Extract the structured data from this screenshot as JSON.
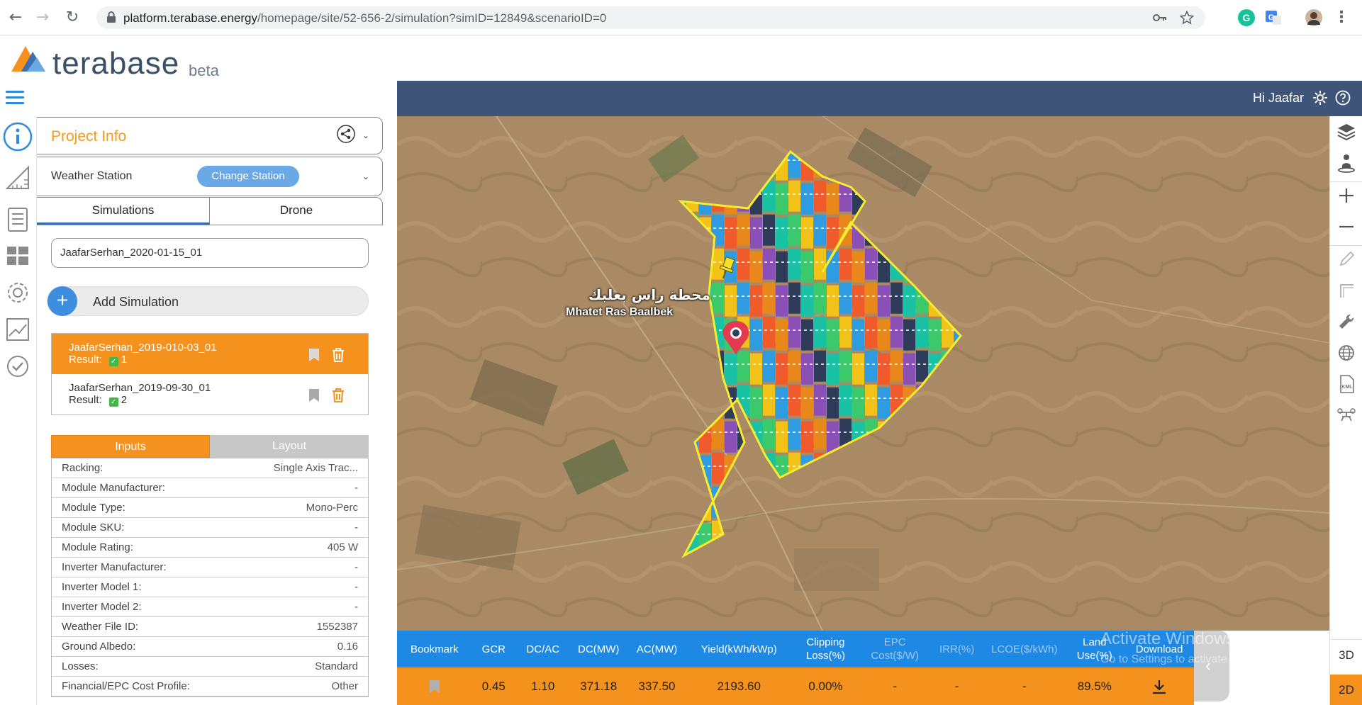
{
  "browser": {
    "url_host": "platform.terabase.energy",
    "url_path": "/homepage/site/52-656-2/simulation?simID=12849&scenarioID=0"
  },
  "app": {
    "logo_text": "terabase",
    "logo_badge": "beta",
    "greeting": "Hi Jaafar"
  },
  "panel": {
    "project_title": "Project Info",
    "weather_label": "Weather Station",
    "change_station_label": "Change Station",
    "tabs": [
      "Simulations",
      "Drone"
    ],
    "sim_name_value": "JaafarSerhan_2020-01-15_01",
    "add_simulation_label": "Add Simulation",
    "simulations": [
      {
        "name": "JaafarSerhan_2019-010-03_01",
        "result_label": "Result:",
        "result_count": "1",
        "active": true
      },
      {
        "name": "JaafarSerhan_2019-09-30_01",
        "result_label": "Result:",
        "result_count": "2",
        "active": false
      }
    ],
    "io_tabs": [
      "Inputs",
      "Layout"
    ],
    "inputs": [
      {
        "label": "Racking:",
        "value": "Single Axis Trac..."
      },
      {
        "label": "Module Manufacturer:",
        "value": "-"
      },
      {
        "label": "Module Type:",
        "value": "Mono-Perc"
      },
      {
        "label": "Module SKU:",
        "value": "-"
      },
      {
        "label": "Module Rating:",
        "value": "405 W"
      },
      {
        "label": "Inverter Manufacturer:",
        "value": "-"
      },
      {
        "label": "Inverter Model 1:",
        "value": "-"
      },
      {
        "label": "Inverter Model 2:",
        "value": "-"
      },
      {
        "label": "Weather File ID:",
        "value": "1552387"
      },
      {
        "label": "Ground Albedo:",
        "value": "0.16"
      },
      {
        "label": "Losses:",
        "value": "Standard"
      },
      {
        "label": "Financial/EPC Cost Profile:",
        "value": "Other"
      }
    ]
  },
  "map": {
    "label_arabic": "محطة راس بعلبك",
    "label_english": "Mhatet Ras Baalbek"
  },
  "map_tools": {
    "view_3d": "3D",
    "view_2d": "2D"
  },
  "results": {
    "headers": [
      "Bookmark",
      "GCR",
      "DC/AC",
      "DC(MW)",
      "AC(MW)",
      "Yield(kWh/kWp)",
      "Clipping Loss(%)",
      "EPC Cost($/W)",
      "IRR(%)",
      "LCOE($/kWh)",
      "Land Use(%)",
      "Download"
    ],
    "row": [
      "",
      "0.45",
      "1.10",
      "371.18",
      "337.50",
      "2193.60",
      "0.00%",
      "-",
      "-",
      "-",
      "89.5%",
      ""
    ]
  },
  "watermark": {
    "title": "Activate Windows",
    "subtitle": "Go to Settings to activate Windows."
  },
  "colors": {
    "accent_orange": "#f5921e",
    "header_blue": "#3e5478",
    "results_blue": "#1e88e5",
    "link_blue": "#3d8ee0"
  }
}
